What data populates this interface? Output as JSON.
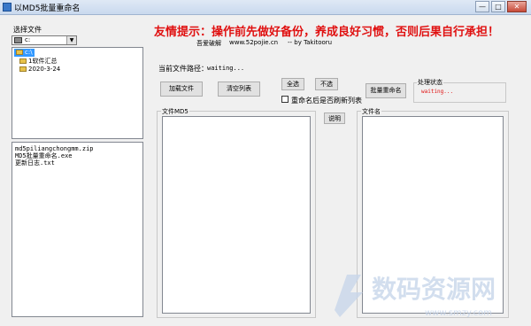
{
  "window": {
    "title": "以MD5批量重命名",
    "minimize_glyph": "—",
    "maximize_glyph": "□",
    "close_glyph": "✕"
  },
  "left": {
    "select_files_label": "选择文件",
    "drive_value": "c:",
    "drive_icon": "hard-drive-icon",
    "tree": [
      {
        "label": "c:\\",
        "selected": true
      },
      {
        "label": "1软件汇总",
        "selected": false
      },
      {
        "label": "2020-3-24",
        "selected": false
      }
    ],
    "files": [
      "md5piliangchongmm.zip",
      "MD5批量重命名.exe",
      "更新日志.txt"
    ]
  },
  "header": {
    "warning": "友情提示：操作前先做好备份，养成良好习惯，否则后果自行承担！",
    "credit_site_label": "吾爱破解",
    "credit_url": "www.52pojie.cn",
    "credit_author": "-- by Takitooru"
  },
  "controls": {
    "path_label": "当前文件路径：",
    "path_value": "waiting...",
    "load_files": "加载文件",
    "clear_list": "清空列表",
    "select_all": "全选",
    "deselect": "不选",
    "refresh_after_rename": "重命名后是否刷新列表",
    "refresh_checked": false,
    "batch_rename": "批量重命名",
    "status_group": "处理状态",
    "status_value": "waiting...",
    "explain": "说明"
  },
  "lists": {
    "md5_title": "文件MD5",
    "name_title": "文件名"
  },
  "watermark": {
    "text": "数码资源网",
    "url": "www.smzy.com"
  },
  "colors": {
    "warning": "#e01010",
    "selection": "#3399ff",
    "watermark": "#c8d6ea"
  }
}
